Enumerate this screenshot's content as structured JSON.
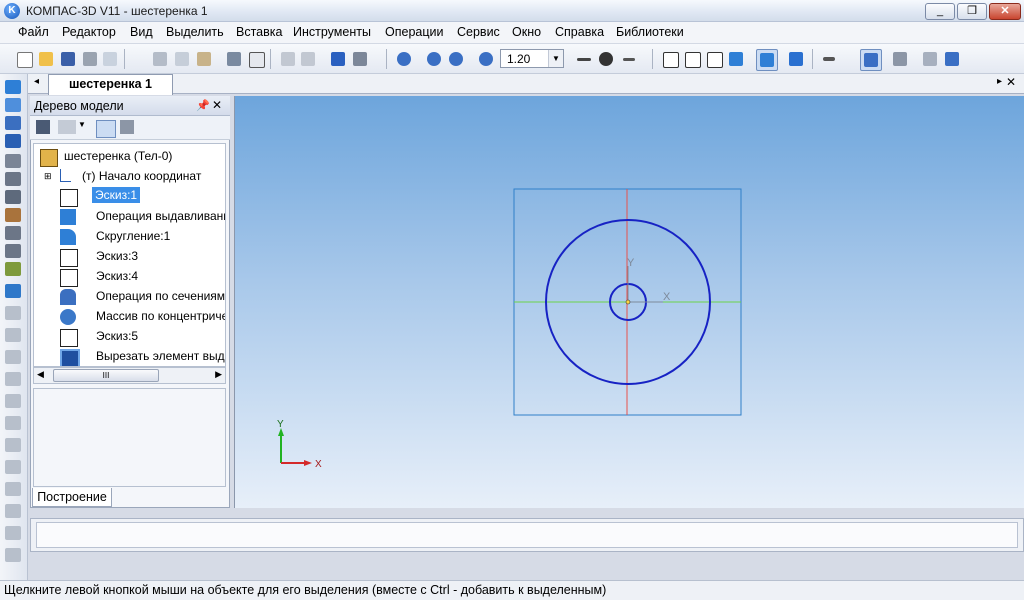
{
  "window": {
    "title": "КОМПАС-3D V11 - шестеренка 1",
    "controls": [
      "_",
      "❐",
      "✕"
    ]
  },
  "menu": [
    "Файл",
    "Редактор",
    "Вид",
    "Выделить",
    "Вставка",
    "Инструменты",
    "Операции",
    "Сервис",
    "Окно",
    "Справка",
    "Библиотеки"
  ],
  "toolbar": {
    "zoom_value": "1.20"
  },
  "document_tab": "шестеренка 1",
  "tree_panel": {
    "title": "Дерево модели",
    "bottom_tab": "Построение",
    "scroll_thumb_label": "III",
    "items": [
      {
        "label": "шестеренка (Тел-0)",
        "icon": "part-icon"
      },
      {
        "label": "(т) Начало координат",
        "icon": "origin-icon"
      },
      {
        "label": "Эскиз:1",
        "icon": "sketch-icon",
        "selected": true
      },
      {
        "label": "Операция выдавливания",
        "icon": "extrude-icon"
      },
      {
        "label": "Скругление:1",
        "icon": "fillet-icon"
      },
      {
        "label": "Эскиз:3",
        "icon": "sketch-icon"
      },
      {
        "label": "Эскиз:4",
        "icon": "sketch-icon"
      },
      {
        "label": "Операция по сечениям",
        "icon": "loft-icon"
      },
      {
        "label": "Массив по концентрической сетке",
        "icon": "pattern-icon"
      },
      {
        "label": "Эскиз:5",
        "icon": "sketch-icon"
      },
      {
        "label": "Вырезать элемент выдавливания",
        "icon": "cut-extrude-icon"
      }
    ]
  },
  "viewport": {
    "sketch_axis_x": "X",
    "sketch_axis_y": "Y",
    "triad_x": "X",
    "triad_y": "Y"
  },
  "status_text": "Щелкните левой кнопкой мыши на объекте для его выделения (вместе с Ctrl - добавить к выделенным)"
}
